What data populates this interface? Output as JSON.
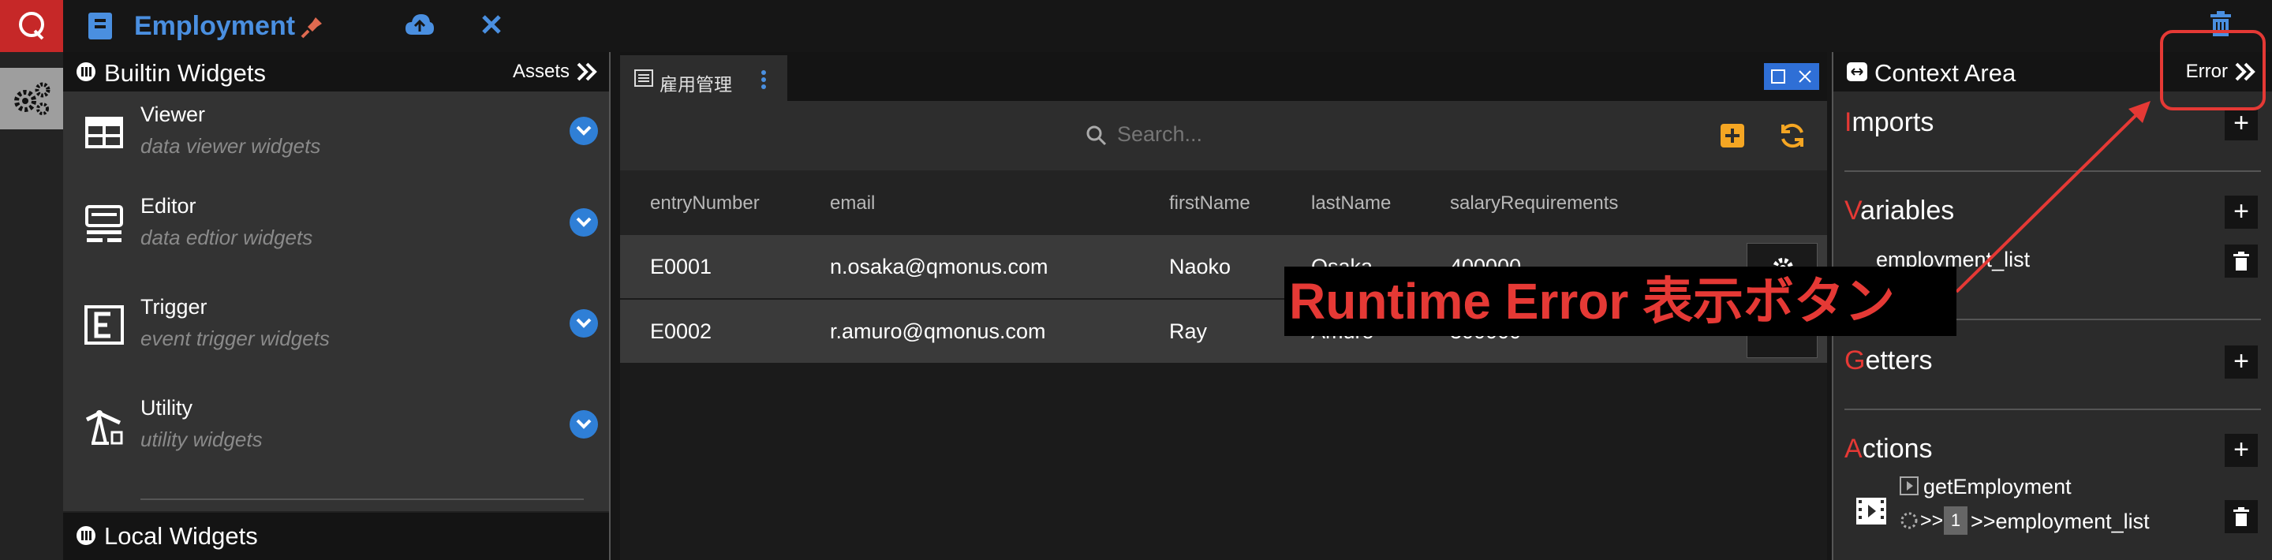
{
  "app": {
    "title": "Employment"
  },
  "left_panel": {
    "title": "Builtin Widgets",
    "assets_label": "Assets",
    "widgets": [
      {
        "title": "Viewer",
        "subtitle": "data viewer widgets"
      },
      {
        "title": "Editor",
        "subtitle": "data edtior widgets"
      },
      {
        "title": "Trigger",
        "subtitle": "event trigger widgets"
      },
      {
        "title": "Utility",
        "subtitle": "utility widgets"
      }
    ],
    "local_title": "Local Widgets"
  },
  "center": {
    "tab_label": "雇用管理",
    "search_placeholder": "Search...",
    "columns": [
      "entryNumber",
      "email",
      "firstName",
      "lastName",
      "salaryRequirements"
    ],
    "rows": [
      [
        "E0001",
        "n.osaka@qmonus.com",
        "Naoko",
        "Osaka",
        "400000"
      ],
      [
        "E0002",
        "r.amuro@qmonus.com",
        "Ray",
        "Amuro",
        "300000"
      ]
    ]
  },
  "right_panel": {
    "title": "Context Area",
    "error_label": "Error",
    "sections": {
      "imports": {
        "first": "I",
        "rest": "mports"
      },
      "variables": {
        "first": "V",
        "rest": "ariables",
        "item": "employment_list"
      },
      "getters": {
        "first": "G",
        "rest": "etters"
      },
      "actions": {
        "first": "A",
        "rest": "ctions",
        "action_name": "getEmployment",
        "prefix": ">>",
        "badge": "1",
        "target": ">>employment_list"
      }
    }
  },
  "annotation": {
    "callout": "Runtime Error 表示ボタン"
  },
  "colors": {
    "accent_blue": "#4a8fe0",
    "accent_red": "#e53935",
    "orange": "#f5a623"
  }
}
